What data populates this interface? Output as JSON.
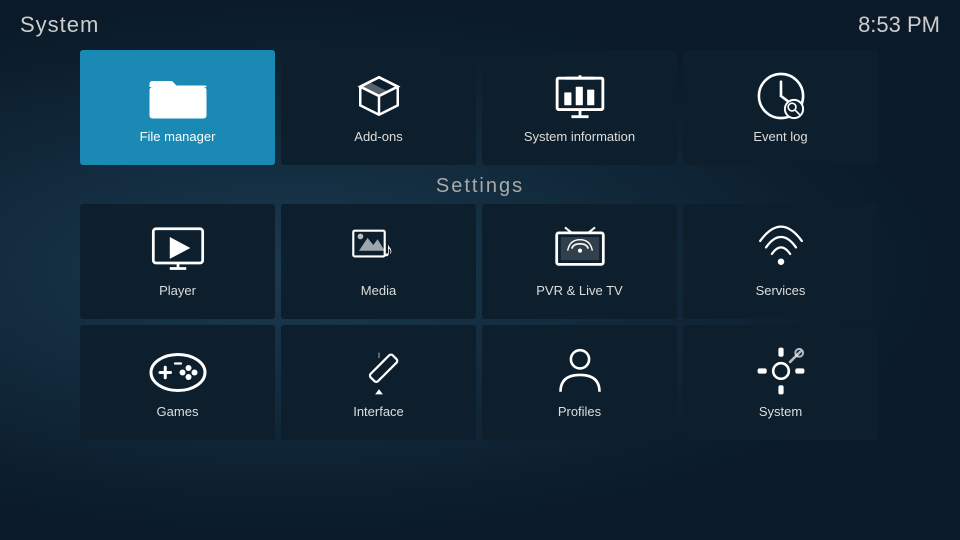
{
  "header": {
    "title": "System",
    "time": "8:53 PM"
  },
  "top_tiles": [
    {
      "id": "file-manager",
      "label": "File manager",
      "active": true
    },
    {
      "id": "add-ons",
      "label": "Add-ons",
      "active": false
    },
    {
      "id": "system-information",
      "label": "System information",
      "active": false
    },
    {
      "id": "event-log",
      "label": "Event log",
      "active": false
    }
  ],
  "settings_heading": "Settings",
  "settings_tiles_row1": [
    {
      "id": "player",
      "label": "Player"
    },
    {
      "id": "media",
      "label": "Media"
    },
    {
      "id": "pvr-live-tv",
      "label": "PVR & Live TV"
    },
    {
      "id": "services",
      "label": "Services"
    }
  ],
  "settings_tiles_row2": [
    {
      "id": "games",
      "label": "Games"
    },
    {
      "id": "interface",
      "label": "Interface"
    },
    {
      "id": "profiles",
      "label": "Profiles"
    },
    {
      "id": "system",
      "label": "System"
    }
  ]
}
